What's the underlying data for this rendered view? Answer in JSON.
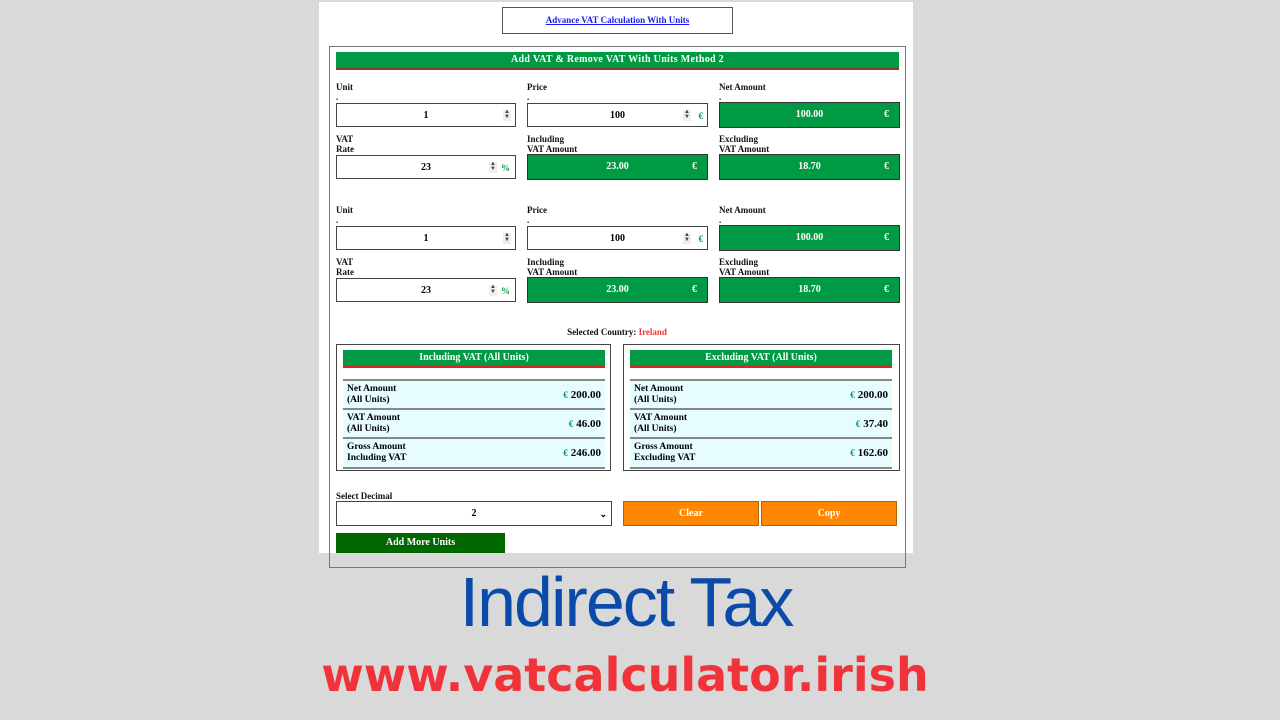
{
  "header_link": "Advance VAT Calculation With Units",
  "form_title": "Add VAT & Remove VAT With Units Method 2",
  "labels": {
    "unit": "Unit",
    "price": "Price",
    "net": "Net Amount",
    "vat1": "VAT",
    "vat2": "Rate",
    "inc1": "Including",
    "inc2": "VAT Amount",
    "exc1": "Excluding",
    "exc2": "VAT Amount",
    "dot": "."
  },
  "units": [
    {
      "unit": "1",
      "price": "100",
      "net": "100.00",
      "rate": "23",
      "including_vat": "23.00",
      "excluding_vat": "18.70"
    },
    {
      "unit": "1",
      "price": "100",
      "net": "100.00",
      "rate": "23",
      "including_vat": "23.00",
      "excluding_vat": "18.70"
    }
  ],
  "currency": "€",
  "percent": "%",
  "country": {
    "label": "Selected Country:",
    "value": "Ireland"
  },
  "including": {
    "title": "Including VAT (All Units)",
    "rows": [
      {
        "k1": "Net Amount",
        "k2": "(All Units)",
        "v": "200.00"
      },
      {
        "k1": "VAT Amount",
        "k2": "(All Units)",
        "v": "46.00"
      },
      {
        "k1": "Gross Amount",
        "k2": "Including VAT",
        "v": "246.00"
      }
    ]
  },
  "excluding": {
    "title": "Excluding VAT (All Units)",
    "rows": [
      {
        "k1": "Net Amount",
        "k2": "(All Units)",
        "v": "200.00"
      },
      {
        "k1": "VAT Amount",
        "k2": "(All Units)",
        "v": "37.40"
      },
      {
        "k1": "Gross Amount",
        "k2": "Excluding VAT",
        "v": "162.60"
      }
    ]
  },
  "decimal": {
    "label": "Select Decimal",
    "value": "2"
  },
  "buttons": {
    "clear": "Clear",
    "copy": "Copy",
    "add_more": "Add More Units"
  },
  "tagline": "Indirect Tax",
  "url": "www.vatcalculator.irish",
  "colors": {
    "green": "#009944",
    "orange": "#ff8800",
    "dark_green": "#006600",
    "tagline_blue": "#0a4aa8",
    "url_red": "#f0333a"
  }
}
